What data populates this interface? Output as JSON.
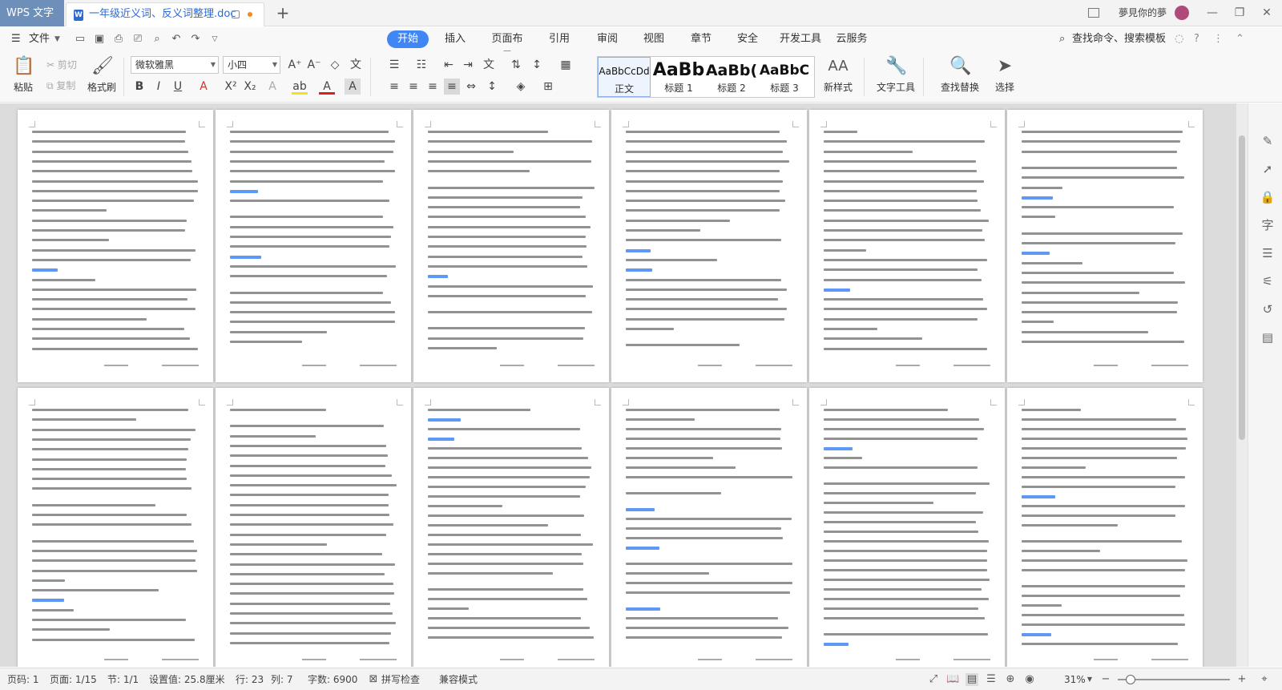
{
  "titlebar": {
    "app_name": "WPS 文字",
    "doc_title": "一年级近义词、反义词整理.doc",
    "user_name": "夢見你的夢",
    "icons": [
      "doc-icon",
      "new-tab-icon",
      "user-avatar-icon"
    ]
  },
  "menubar": {
    "file_label": "文件",
    "tabs": [
      "开始",
      "插入",
      "页面布局",
      "引用",
      "审阅",
      "视图",
      "章节",
      "安全",
      "开发工具",
      "云服务"
    ],
    "active_tab": "开始",
    "search_label": "查找命令、搜索模板"
  },
  "ribbon": {
    "paste": "粘贴",
    "cut": "剪切",
    "copy": "复制",
    "format_painter": "格式刷",
    "font_name": "微软雅黑",
    "font_size": "小四",
    "styles": [
      {
        "preview": "AaBbCcDd",
        "name": "正文"
      },
      {
        "preview": "AaBb",
        "name": "标题 1"
      },
      {
        "preview": "AaBb(",
        "name": "标题 2"
      },
      {
        "preview": "AaBbC",
        "name": "标题 3"
      }
    ],
    "new_style": "新样式",
    "text_tools": "文字工具",
    "find_replace": "查找替换",
    "select": "选择"
  },
  "statusbar": {
    "page_code": "页码: 1",
    "pages": "页面: 1/15",
    "section": "节: 1/1",
    "setting": "设置值: 25.8厘米",
    "row": "行: 23",
    "col": "列: 7",
    "words": "字数: 6900",
    "spell_check": "拼写检查",
    "compat_mode": "兼容模式",
    "zoom": "31%"
  },
  "colors": {
    "accent": "#4186f5",
    "app_tab": "#6e8fb9"
  }
}
